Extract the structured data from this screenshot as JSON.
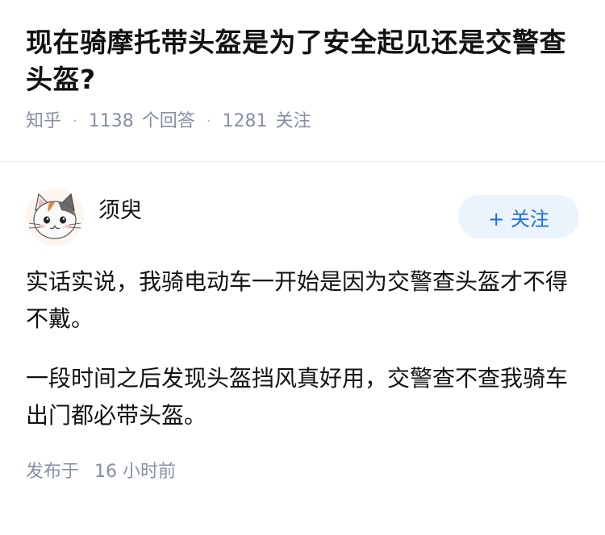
{
  "question": {
    "title": "现在骑摩托带头盔是为了安全起见还是交警查头盔?",
    "source": "知乎",
    "answer_count": "1138",
    "answer_label": "个回答",
    "follow_count": "1281",
    "follow_label": "关注"
  },
  "answer": {
    "author_name": "须臾",
    "follow_button": "+ 关注",
    "paragraphs": [
      "实话实说，我骑电动车一开始是因为交警查头盔才不得不戴。",
      "一段时间之后发现头盔挡风真好用，交警查不查我骑车出门都必带头盔。"
    ],
    "published_label": "发布于",
    "published_time": "16 小时前"
  },
  "icons": {
    "avatar": "cat-avatar-icon"
  }
}
